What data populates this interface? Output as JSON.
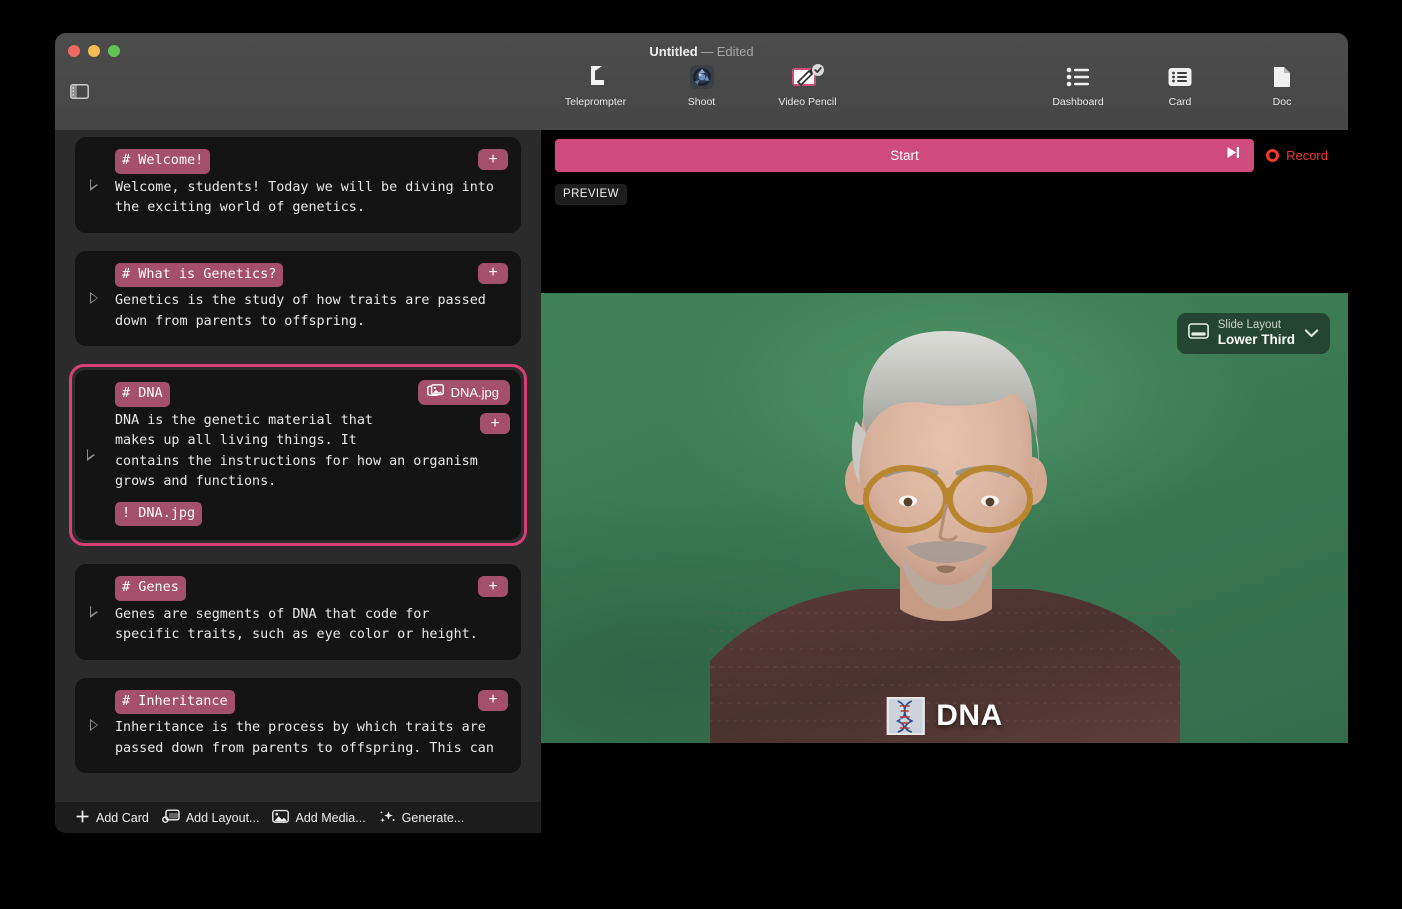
{
  "window": {
    "title_name": "Untitled",
    "title_dash": "—",
    "title_state": "Edited"
  },
  "toolbar": {
    "sidebar_toggle_icon": "sidebar-toggle-icon",
    "center_items": [
      {
        "label": "Teleprompter",
        "icon": "teleprompter-icon"
      },
      {
        "label": "Shoot",
        "icon": "camera-shoot-icon"
      },
      {
        "label": "Video Pencil",
        "icon": "video-pencil-icon"
      }
    ],
    "right_items": [
      {
        "label": "Dashboard",
        "icon": "dashboard-list-icon"
      },
      {
        "label": "Card",
        "icon": "card-icon"
      },
      {
        "label": "Doc",
        "icon": "doc-icon"
      }
    ]
  },
  "cards": [
    {
      "heading": "# Welcome!",
      "text": "Welcome, students! Today we will be diving into\nthe exciting world of genetics.",
      "add_label": "+",
      "selected": false,
      "media_badge": null,
      "media_tag": null
    },
    {
      "heading": "# What is Genetics?",
      "text": "Genetics is the study of how traits are passed\ndown from parents to offspring.",
      "add_label": "+",
      "selected": false,
      "media_badge": null,
      "media_tag": null
    },
    {
      "heading": "# DNA",
      "text": "DNA is the genetic material that\nmakes up all living things. It\ncontains the instructions for how an organism\ngrows and functions.",
      "add_label": "+",
      "selected": true,
      "media_badge": "DNA.jpg",
      "media_tag": "! DNA.jpg"
    },
    {
      "heading": "# Genes",
      "text": "Genes are segments of DNA that code for\nspecific traits, such as eye color or height.",
      "add_label": "+",
      "selected": false,
      "media_badge": null,
      "media_tag": null
    },
    {
      "heading": "# Inheritance",
      "text": "Inheritance is the process by which traits are\npassed down from parents to offspring. This can",
      "add_label": "+",
      "selected": false,
      "media_badge": null,
      "media_tag": null
    }
  ],
  "bottom_toolbar": [
    {
      "label": "Add Card",
      "icon": "plus-icon"
    },
    {
      "label": "Add Layout...",
      "icon": "layout-icon"
    },
    {
      "label": "Add Media...",
      "icon": "media-image-icon"
    },
    {
      "label": "Generate...",
      "icon": "sparkles-icon"
    }
  ],
  "preview": {
    "start_label": "Start",
    "skip_icon": "skip-forward-icon",
    "record_label": "Record",
    "record_icon": "record-dot-icon",
    "preview_badge": "PREVIEW",
    "slide_layout": {
      "title": "Slide Layout",
      "value": "Lower Third",
      "icon": "slide-layout-icon",
      "chevron": "chevron-down-icon"
    },
    "lower_third": {
      "label": "DNA",
      "thumb_icon": "dna-image-thumbnail"
    }
  },
  "colors": {
    "accent_pink": "#d04b7d",
    "tag_pink": "#a4506d",
    "selection_border": "#d93f77",
    "record_red": "#f03a2f",
    "green_screen": "#3e7d55",
    "card_bg": "#141414",
    "panel_bg": "#2b2b2b",
    "titlebar_bg": "#4a4a4a"
  }
}
